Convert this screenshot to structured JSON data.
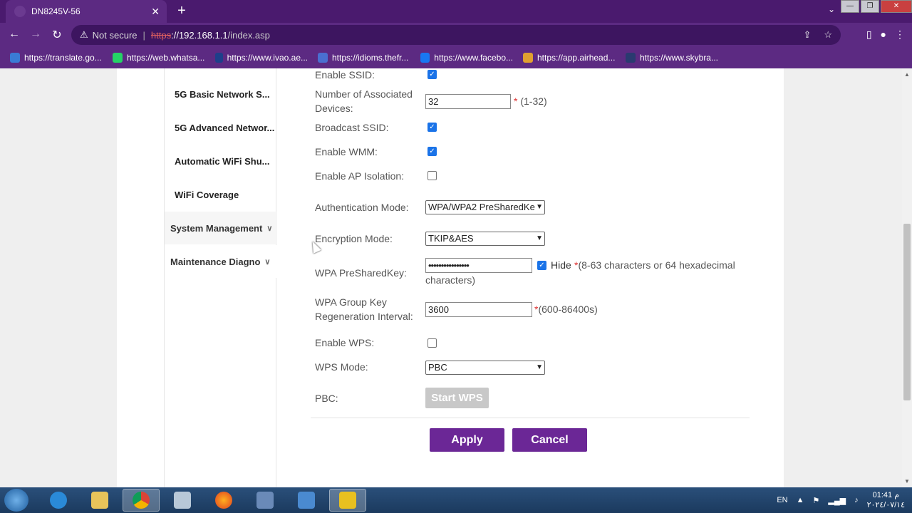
{
  "browser": {
    "tab_title": "DN8245V-56",
    "tab_close": "✕",
    "new_tab": "+",
    "security_label": "Not secure",
    "url_scheme": "https",
    "url_host": "://192.168.1.1",
    "url_path": "/index.asp",
    "bookmarks": [
      {
        "label": "https://translate.go...",
        "color": "#3a7bd5"
      },
      {
        "label": "https://web.whatsa...",
        "color": "#25d366"
      },
      {
        "label": "https://www.ivao.ae...",
        "color": "#1e3f8a"
      },
      {
        "label": "https://idioms.thefr...",
        "color": "#4a6fd0"
      },
      {
        "label": "https://www.facebo...",
        "color": "#1877f2"
      },
      {
        "label": "https://app.airhead...",
        "color": "#e0a030"
      },
      {
        "label": "https://www.skybra...",
        "color": "#2a3a70"
      }
    ]
  },
  "sidebar": {
    "items": [
      "5G Basic Network S...",
      "5G Advanced Networ...",
      "Automatic WiFi Shu...",
      "WiFi Coverage"
    ],
    "groups": [
      "System Management",
      "Maintenance Diagno"
    ]
  },
  "form": {
    "enable_ssid": "Enable SSID:",
    "assoc_devices_line1": "Number of Associated",
    "assoc_devices_line2": "Devices:",
    "assoc_devices_value": "32",
    "assoc_devices_hint": "(1-32)",
    "broadcast_ssid": "Broadcast SSID:",
    "enable_wmm": "Enable WMM:",
    "enable_ap_isolation": "Enable AP Isolation:",
    "auth_mode_label": "Authentication Mode:",
    "auth_mode_value": "WPA/WPA2 PreSharedKe",
    "enc_mode_label": "Encryption Mode:",
    "enc_mode_value": "TKIP&AES",
    "psk_label": "WPA PreSharedKey:",
    "psk_value": "••••••••••••••••",
    "hide_label": "Hide",
    "psk_hint_line1": "(8-63 characters or 64 hexadecimal",
    "psk_hint_line2": "characters)",
    "group_key_line1": "WPA Group Key",
    "group_key_line2": "Regeneration Interval:",
    "group_key_value": "3600",
    "group_key_hint": "(600-86400s)",
    "enable_wps": "Enable WPS:",
    "wps_mode_label": "WPS Mode:",
    "wps_mode_value": "PBC",
    "pbc_label": "PBC:",
    "start_wps": "Start WPS",
    "apply": "Apply",
    "cancel": "Cancel",
    "required_mark": "*"
  },
  "taskbar": {
    "lang": "EN",
    "time": "01:41 م",
    "date": "٢٠٢٤/٠٧/١٤"
  }
}
